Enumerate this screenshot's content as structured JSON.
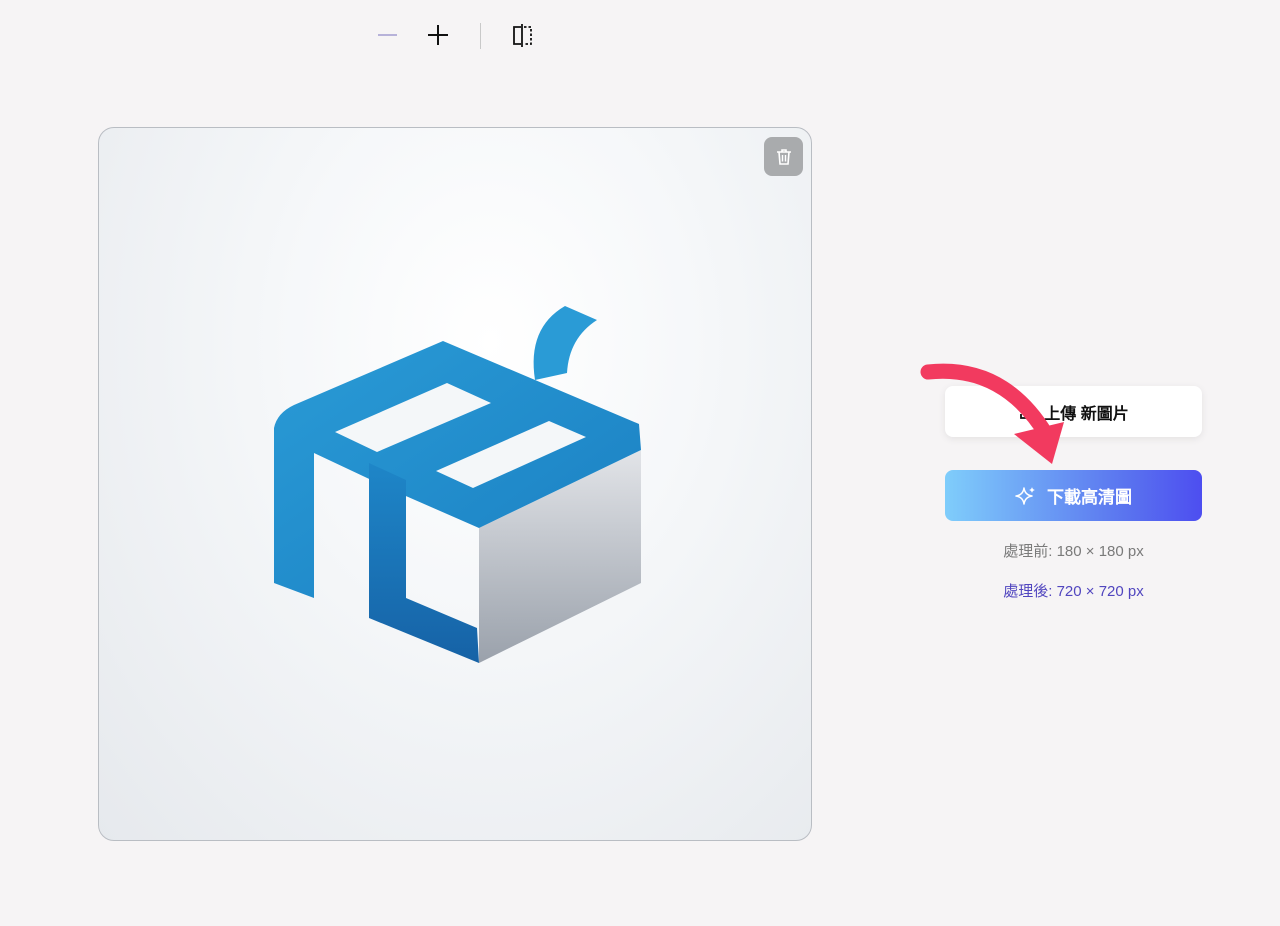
{
  "toolbar": {
    "zoom_out_icon": "minus-icon",
    "zoom_in_icon": "plus-icon",
    "compare_icon": "split-compare-icon"
  },
  "image_card": {
    "delete_icon": "trash-icon"
  },
  "actions": {
    "upload_label": "上傳 新圖片",
    "upload_icon": "upload-icon",
    "download_label": "下載高清圖",
    "download_icon": "sparkle-icon"
  },
  "info": {
    "before": "處理前: 180 × 180 px",
    "after": "處理後: 720 × 720 px"
  },
  "colors": {
    "background": "#f6f4f5",
    "download_gradient_start": "#7fcdfb",
    "download_gradient_end": "#4d4ef0",
    "after_text": "#5146bf",
    "annotation_arrow": "#f23a5f",
    "logo_blue": "#1f86c4"
  }
}
